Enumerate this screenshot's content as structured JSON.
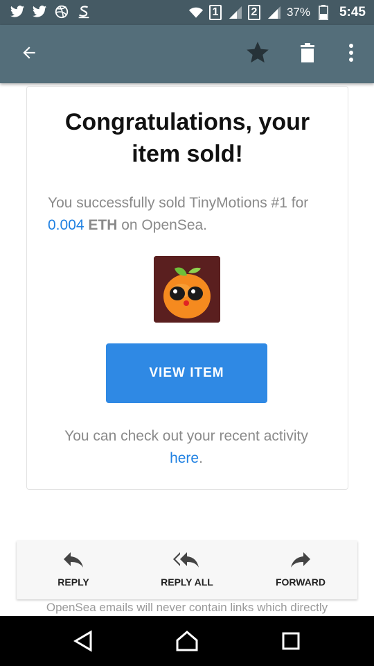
{
  "status_bar": {
    "left_icons": [
      "twitter-icon",
      "twitter-icon",
      "dribbble-icon",
      "stripe-icon"
    ],
    "sim1": "1",
    "sim2": "2",
    "battery": "37%",
    "time": "5:45"
  },
  "app_bar": {
    "back_icon": "arrow-left-icon",
    "actions": [
      "star-icon",
      "trash-icon",
      "more-vert-icon"
    ]
  },
  "email": {
    "title": "Congratulations, your item sold!",
    "desc_prefix": "You successfully sold TinyMotions #1 for ",
    "price": "0.004",
    "currency": "ETH",
    "desc_suffix": " on OpenSea.",
    "button": "VIEW ITEM",
    "activity_prefix": "You can check out your recent activity ",
    "activity_link": "here",
    "activity_suffix": ".",
    "footer": "OpenSea emails will never contain links which directly"
  },
  "reply_bar": {
    "reply": "REPLY",
    "reply_all": "REPLY ALL",
    "forward": "FORWARD"
  },
  "colors": {
    "status_bar": "#455a64",
    "app_bar": "#546e7a",
    "accent": "#2081e2",
    "button": "#2f89e4"
  }
}
